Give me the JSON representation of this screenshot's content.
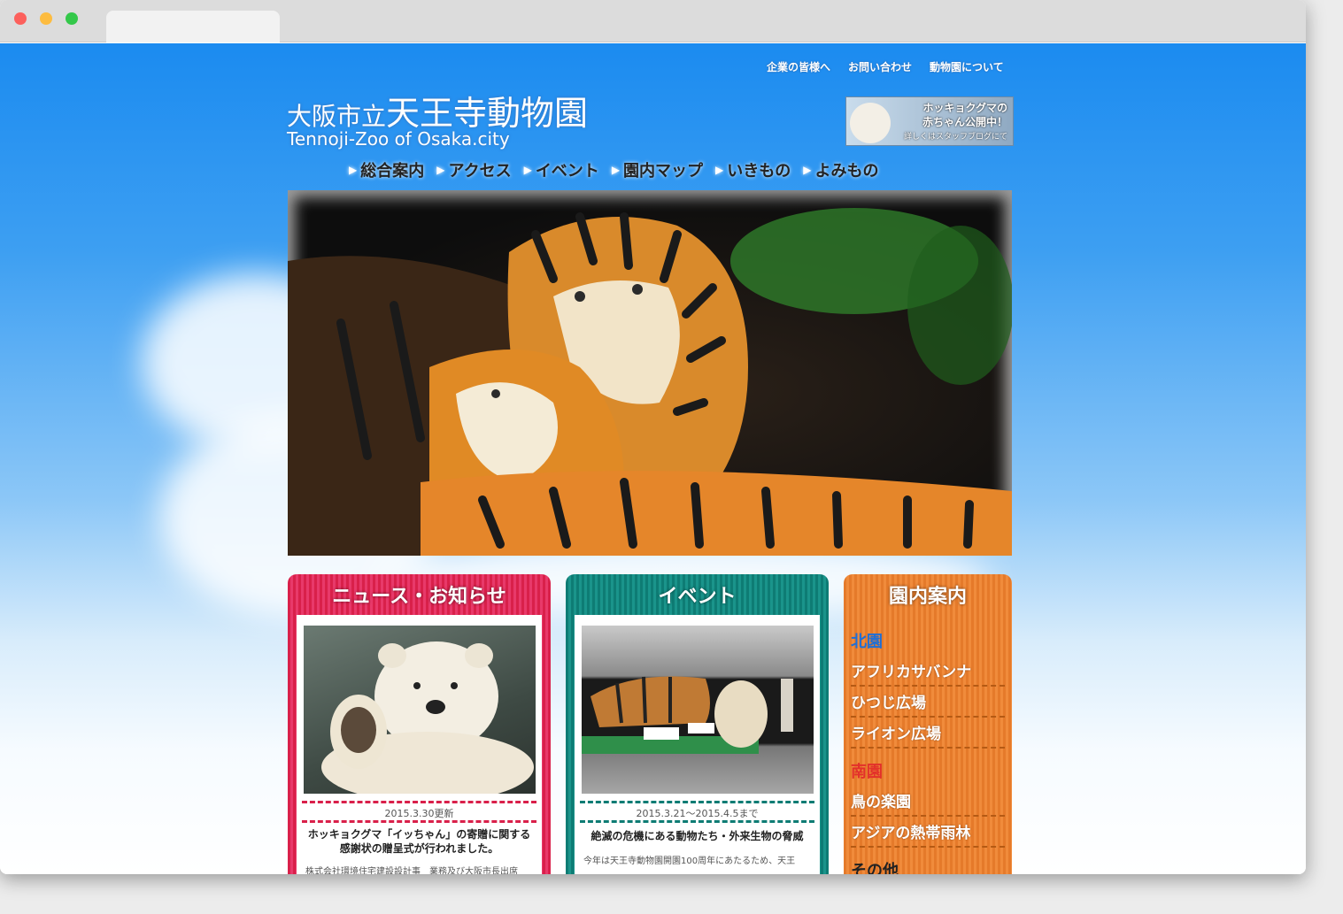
{
  "browser": {
    "tab_title": ""
  },
  "top_links": [
    "企業の皆様へ",
    "お問い合わせ",
    "動物園について"
  ],
  "logo": {
    "prefix": "大阪市立",
    "name": "天王寺動物園",
    "english": "Tennoji-Zoo of Osaka.city"
  },
  "banner": {
    "line1": "ホッキョクグマの",
    "line2": "赤ちゃん公開中！",
    "line3": "詳しくはスタッフブログにて"
  },
  "nav": [
    "総合案内",
    "アクセス",
    "イベント",
    "園内マップ",
    "いきもの",
    "よみもの"
  ],
  "news": {
    "title": "ニュース・お知らせ",
    "date": "2015.3.30更新",
    "headline": "ホッキョクグマ「イッちゃん」の寄贈に関する感謝状の贈呈式が行われました。",
    "snippet": "株式会社環境住宅建設設計事　業務及び大阪市長出席"
  },
  "event": {
    "title": "イベント",
    "date": "2015.3.21〜2015.4.5まで",
    "headline": "絶滅の危機にある動物たち・外来生物の脅威",
    "snippet": "今年は天王寺動物園開園100周年にあたるため、天王"
  },
  "guide": {
    "title": "園内案内",
    "north_label": "北園",
    "north": [
      "アフリカサバンナ",
      "ひつじ広場",
      "ライオン広場"
    ],
    "south_label": "南園",
    "south": [
      "鳥の楽園",
      "アジアの熱帯雨林"
    ],
    "other_label": "その他"
  },
  "colors": {
    "news": "#d9204a",
    "event": "#0e7c74",
    "guide": "#e57a2a",
    "sky": "#1b8bf0"
  }
}
